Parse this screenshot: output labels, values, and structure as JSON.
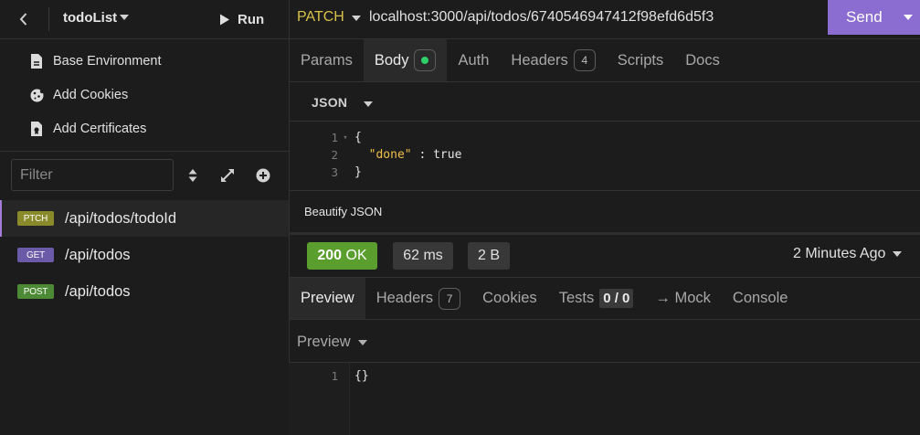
{
  "project": {
    "name": "todoList",
    "run_label": "Run"
  },
  "sidebar_menu": [
    {
      "label": "Base Environment",
      "icon": "document-icon"
    },
    {
      "label": "Add Cookies",
      "icon": "cookie-icon"
    },
    {
      "label": "Add Certificates",
      "icon": "certificate-icon"
    }
  ],
  "filter": {
    "placeholder": "Filter"
  },
  "requests": [
    {
      "method": "PTCH",
      "path": "/api/todos/todoId",
      "color": "#8a8a2a",
      "active": true
    },
    {
      "method": "GET",
      "path": "/api/todos",
      "color": "#6a5aa8",
      "active": false
    },
    {
      "method": "POST",
      "path": "/api/todos",
      "color": "#4d8a36",
      "active": false
    }
  ],
  "url_bar": {
    "method": "PATCH",
    "method_color": "#d7c24a",
    "url": "localhost:3000/api/todos/6740546947412f98efd6d5f3",
    "send_label": "Send",
    "send_color": "#8b6cd0"
  },
  "request_tabs": {
    "params": "Params",
    "body": "Body",
    "auth": "Auth",
    "headers": "Headers",
    "headers_count": "4",
    "scripts": "Scripts",
    "docs": "Docs"
  },
  "body_editor": {
    "format": "JSON",
    "lines": [
      {
        "num": "1",
        "text": "{"
      },
      {
        "num": "2",
        "key": "\"done\"",
        "sep": " : ",
        "value": "true"
      },
      {
        "num": "3",
        "text": "}"
      }
    ],
    "beautify_label": "Beautify JSON"
  },
  "response_status": {
    "code": "200",
    "text": "OK",
    "status_color": "#5a9e2e",
    "time": "62 ms",
    "size": "2 B",
    "time_ago": "2 Minutes Ago"
  },
  "response_tabs": {
    "preview": "Preview",
    "headers": "Headers",
    "headers_count": "7",
    "cookies": "Cookies",
    "tests": "Tests",
    "tests_count": "0 / 0",
    "mock": "→ Mock",
    "console": "Console"
  },
  "response_preview": {
    "mode": "Preview",
    "lines": [
      {
        "num": "1",
        "text": "{}"
      }
    ]
  }
}
